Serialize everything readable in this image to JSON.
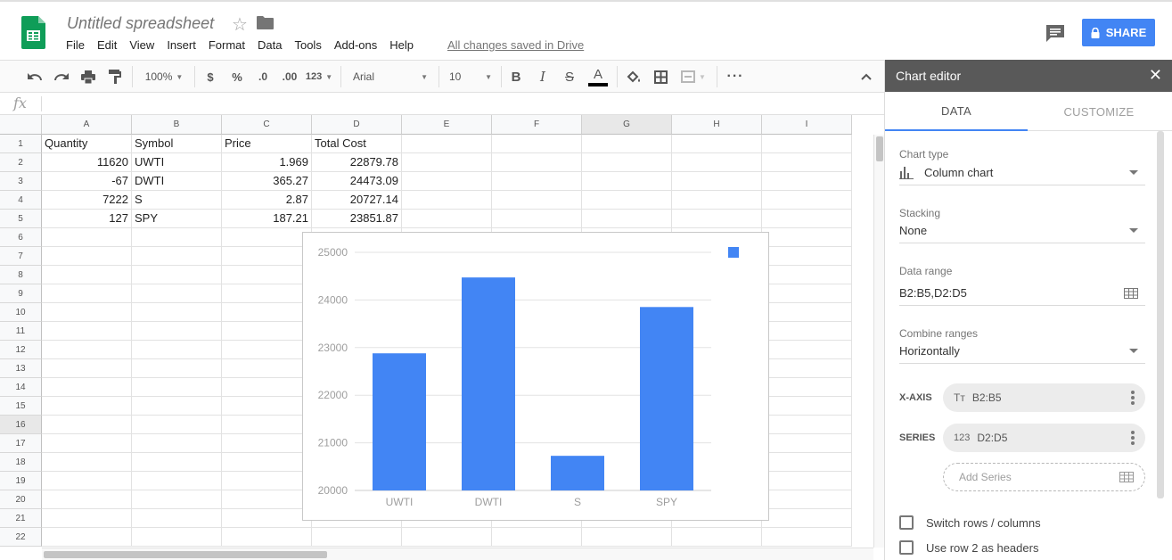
{
  "app": {
    "doc_title": "Untitled spreadsheet",
    "menu": [
      "File",
      "Edit",
      "View",
      "Insert",
      "Format",
      "Data",
      "Tools",
      "Add-ons",
      "Help"
    ],
    "saved_status": "All changes saved in Drive",
    "share_label": "SHARE",
    "brand_color": "#0f9d58",
    "accent_color": "#4285f4"
  },
  "toolbar": {
    "zoom": "100%",
    "currency": "$",
    "percent": "%",
    "dec_decrease": ".0",
    "dec_increase": ".00",
    "more_formats": "123",
    "font": "Arial",
    "font_size": "10",
    "bold": "B",
    "italic": "I",
    "strike": "S",
    "text_color_letter": "A"
  },
  "formula_bar": {
    "fx": "fx",
    "value": ""
  },
  "sheet": {
    "columns": [
      "A",
      "B",
      "C",
      "D",
      "E",
      "F",
      "G",
      "H",
      "I"
    ],
    "rows": [
      "1",
      "2",
      "3",
      "4",
      "5",
      "6",
      "7",
      "8",
      "9",
      "10",
      "11",
      "12",
      "13",
      "14",
      "15",
      "16",
      "17",
      "18",
      "19",
      "20",
      "21",
      "22"
    ],
    "cells": [
      [
        "Quantity",
        "Symbol",
        "Price",
        "Total Cost"
      ],
      [
        "11620",
        "UWTI",
        "1.969",
        "22879.78"
      ],
      [
        "-67",
        "DWTI",
        "365.27",
        "24473.09"
      ],
      [
        "7222",
        "S",
        "2.87",
        "20727.14"
      ],
      [
        "127",
        "SPY",
        "187.21",
        "23851.87"
      ]
    ]
  },
  "chart_data": {
    "type": "bar",
    "categories": [
      "UWTI",
      "DWTI",
      "S",
      "SPY"
    ],
    "values": [
      22879.78,
      24473.09,
      20727.14,
      23851.87
    ],
    "ylim": [
      20000,
      25000
    ],
    "yticks": [
      "25000",
      "24000",
      "23000",
      "22000",
      "21000",
      "20000"
    ],
    "grid": true,
    "legend": "top-right",
    "bar_color": "#4285f4"
  },
  "panel": {
    "title": "Chart editor",
    "close": "✕",
    "tabs": [
      "DATA",
      "CUSTOMIZE"
    ],
    "chart_type_label": "Chart type",
    "chart_type": "Column chart",
    "stacking_label": "Stacking",
    "stacking": "None",
    "data_range_label": "Data range",
    "data_range": "B2:B5,D2:D5",
    "combine_label": "Combine ranges",
    "combine": "Horizontally",
    "xaxis_label": "X-AXIS",
    "xaxis_icon": "Tт",
    "xaxis_range": "B2:B5",
    "series_label": "SERIES",
    "series_icon": "123",
    "series_range": "D2:D5",
    "add_series": "Add Series",
    "switch_rows": "Switch rows / columns",
    "use_row_headers": "Use row 2 as headers"
  }
}
